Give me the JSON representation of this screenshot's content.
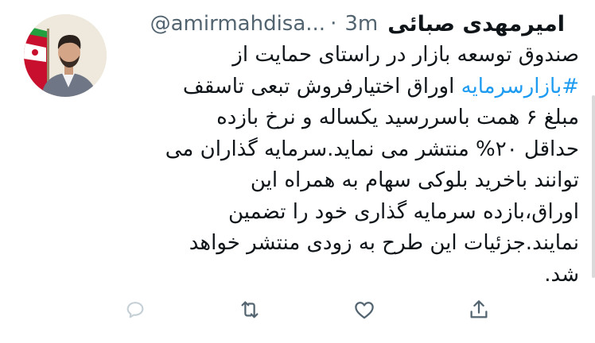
{
  "tweet": {
    "display_name": "امیرمهدی صبائی",
    "handle": "@amirmahdisa...",
    "separator": "·",
    "time": "3m",
    "lines": [
      "صندوق توسعه بازار در راستای حمایت از",
      "اوراق اختیارفروش تبعی تاسقف",
      "مبلغ ۶ همت باسررسید یکساله و نرخ بازده",
      "حداقل ۲۰% منتشر می نماید.سرمایه گذاران می",
      "توانند باخرید بلوکی سهام به همراه این",
      "اوراق،بازده سرمایه گذاری خود را تضمین",
      "نمایند.جزئیات این طرح به زودی منتشر خواهد",
      "شد."
    ],
    "hashtag": "#بازارسرمایه"
  },
  "actions": {
    "reply_icon": "reply-icon",
    "retweet_icon": "retweet-icon",
    "like_icon": "heart-icon",
    "share_icon": "share-icon"
  },
  "colors": {
    "text": "#0f1419",
    "secondary": "#536471",
    "link": "#1d9bf0"
  }
}
